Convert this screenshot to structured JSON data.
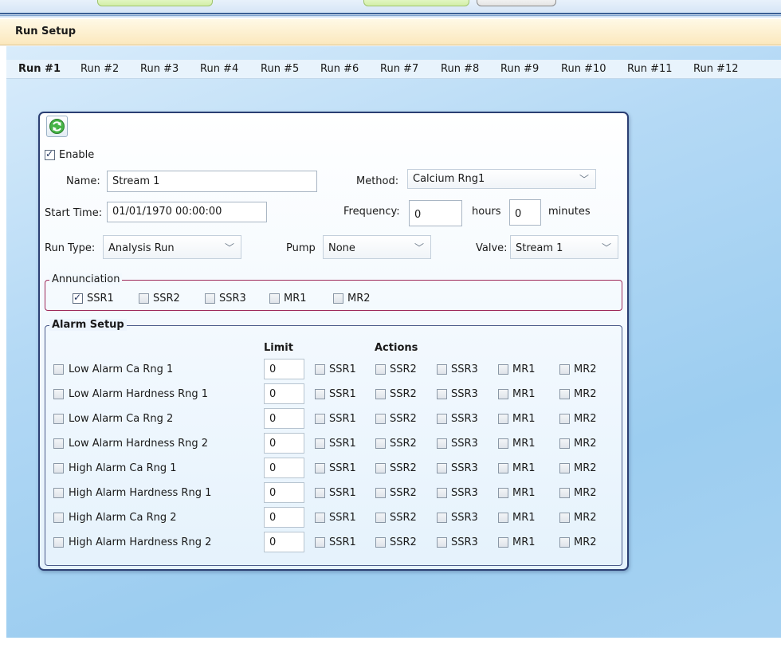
{
  "page": {
    "title": "Run Setup"
  },
  "tabs": [
    "Run #1",
    "Run #2",
    "Run #3",
    "Run #4",
    "Run #5",
    "Run #6",
    "Run #7",
    "Run #8",
    "Run #9",
    "Run #10",
    "Run #11",
    "Run #12"
  ],
  "active_tab": "Run #1",
  "form": {
    "enable_label": "Enable",
    "enable_checked": true,
    "name_label": "Name:",
    "name_value": "Stream 1",
    "method_label": "Method:",
    "method_value": "Calcium Rng1",
    "start_time_label": "Start Time:",
    "start_time_value": "01/01/1970 00:00:00",
    "frequency_label": "Frequency:",
    "frequency_hours": "0",
    "hours_label": "hours",
    "frequency_minutes": "0",
    "minutes_label": "minutes",
    "run_type_label": "Run Type:",
    "run_type_value": "Analysis Run",
    "pump_label": "Pump",
    "pump_value": "None",
    "valve_label": "Valve:",
    "valve_value": "Stream 1"
  },
  "annunciation": {
    "legend": "Annunciation",
    "options": [
      {
        "label": "SSR1",
        "checked": true
      },
      {
        "label": "SSR2",
        "checked": false
      },
      {
        "label": "SSR3",
        "checked": false
      },
      {
        "label": "MR1",
        "checked": false
      },
      {
        "label": "MR2",
        "checked": false
      }
    ]
  },
  "alarm_setup": {
    "legend": "Alarm Setup",
    "limit_header": "Limit",
    "actions_header": "Actions",
    "action_labels": [
      "SSR1",
      "SSR2",
      "SSR3",
      "MR1",
      "MR2"
    ],
    "rows": [
      {
        "label": "Low Alarm Ca Rng 1",
        "limit": "0"
      },
      {
        "label": "Low Alarm Hardness Rng 1",
        "limit": "0"
      },
      {
        "label": "Low Alarm Ca Rng 2",
        "limit": "0"
      },
      {
        "label": "Low Alarm Hardness Rng 2",
        "limit": "0"
      },
      {
        "label": "High Alarm Ca Rng 1",
        "limit": "0"
      },
      {
        "label": "High Alarm Hardness Rng 1",
        "limit": "0"
      },
      {
        "label": "High Alarm Ca Rng 2",
        "limit": "0"
      },
      {
        "label": "High Alarm Hardness Rng 2",
        "limit": "0"
      }
    ]
  },
  "icons": {
    "refresh": "refresh-icon",
    "dropdown": "chevron-down-icon"
  },
  "colors": {
    "panel_border": "#2b3f73",
    "annunciation_border": "#9e2a5a",
    "titlebar": "#fbe8bd",
    "refresh_icon": "#3aa63a"
  }
}
